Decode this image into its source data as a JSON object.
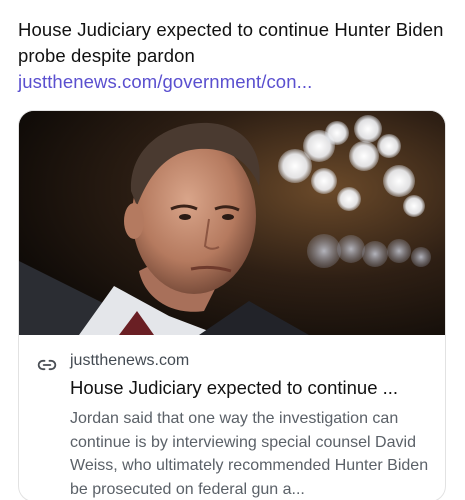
{
  "post": {
    "text": "House Judiciary expected to continue Hunter Biden probe despite pardon ",
    "link_text": "justthenews.com/government/con..."
  },
  "card": {
    "image_icon": "photo-of-man-bokeh-lights",
    "link_icon": "link-icon",
    "domain": "justthenews.com",
    "title": "House Judiciary expected to continue ...",
    "description": "Jordan said that one way the investigation can continue is by interviewing special counsel David Weiss, who ultimately recommended Hunter Biden be prosecuted on federal gun a..."
  },
  "colors": {
    "link": "#5a4fcf",
    "text": "#111111",
    "muted": "#5b6168",
    "border": "#e2e2e2"
  }
}
